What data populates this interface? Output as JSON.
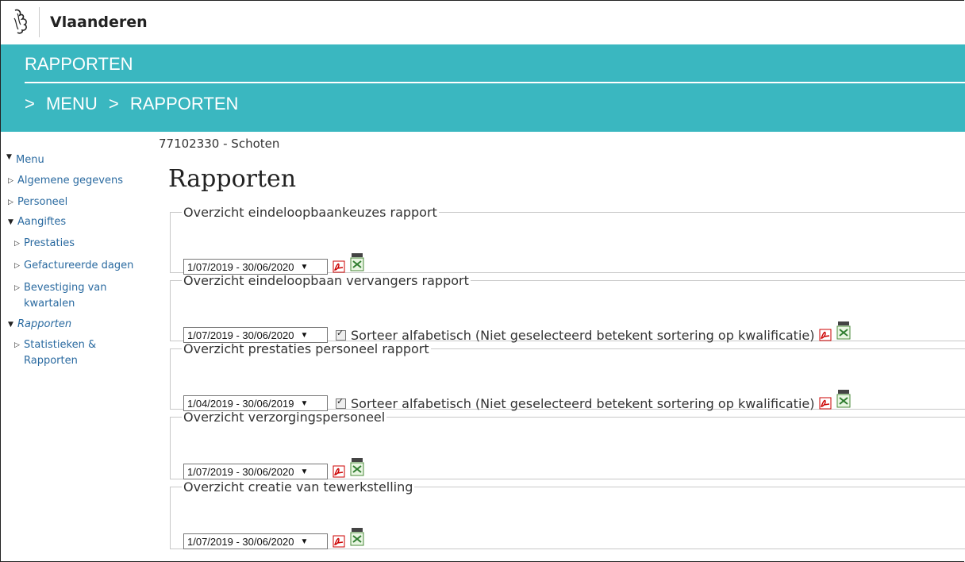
{
  "brand": "Vlaanderen",
  "header": {
    "title": "RAPPORTEN",
    "breadcrumb": [
      ">",
      "MENU",
      ">",
      "RAPPORTEN"
    ]
  },
  "sidebar": {
    "items": [
      {
        "label": "Menu",
        "expanded": true
      },
      {
        "label": "Algemene gegevens"
      },
      {
        "label": "Personeel"
      },
      {
        "label": "Aangiftes",
        "expanded": true
      },
      {
        "label": "Prestaties"
      },
      {
        "label": "Gefactureerde dagen"
      },
      {
        "label": "Bevestiging van kwartalen"
      },
      {
        "label": "Rapporten",
        "expanded": true,
        "active": true
      },
      {
        "label": "Statistieken & Rapporten"
      }
    ]
  },
  "entity": "77102330 - Schoten",
  "page_title": "Rapporten",
  "panels": [
    {
      "legend": "Overzicht eindeloopbaankeuzes rapport",
      "period": "1/07/2019 - 30/06/2020",
      "has_checkbox": false
    },
    {
      "legend": "Overzicht eindeloopbaan vervangers rapport",
      "period": "1/07/2019 - 30/06/2020",
      "has_checkbox": true,
      "checkbox_label": "Sorteer alfabetisch (Niet geselecteerd betekent sortering op kwalificatie)"
    },
    {
      "legend": "Overzicht prestaties personeel rapport",
      "period": "1/04/2019 - 30/06/2019",
      "has_checkbox": true,
      "checkbox_label": "Sorteer alfabetisch (Niet geselecteerd betekent sortering op kwalificatie)"
    },
    {
      "legend": "Overzicht verzorgingspersoneel",
      "period": "1/07/2019 - 30/06/2020",
      "has_checkbox": false
    },
    {
      "legend": "Overzicht creatie van tewerkstelling",
      "period": "1/07/2019 - 30/06/2020",
      "has_checkbox": false
    }
  ],
  "icons": {
    "pdf": "pdf-icon",
    "xlsx": "xlsx-icon",
    "logo": "flemish-lion-logo"
  },
  "colors": {
    "header": "#3ab7c0",
    "link": "#2a6aa0"
  }
}
